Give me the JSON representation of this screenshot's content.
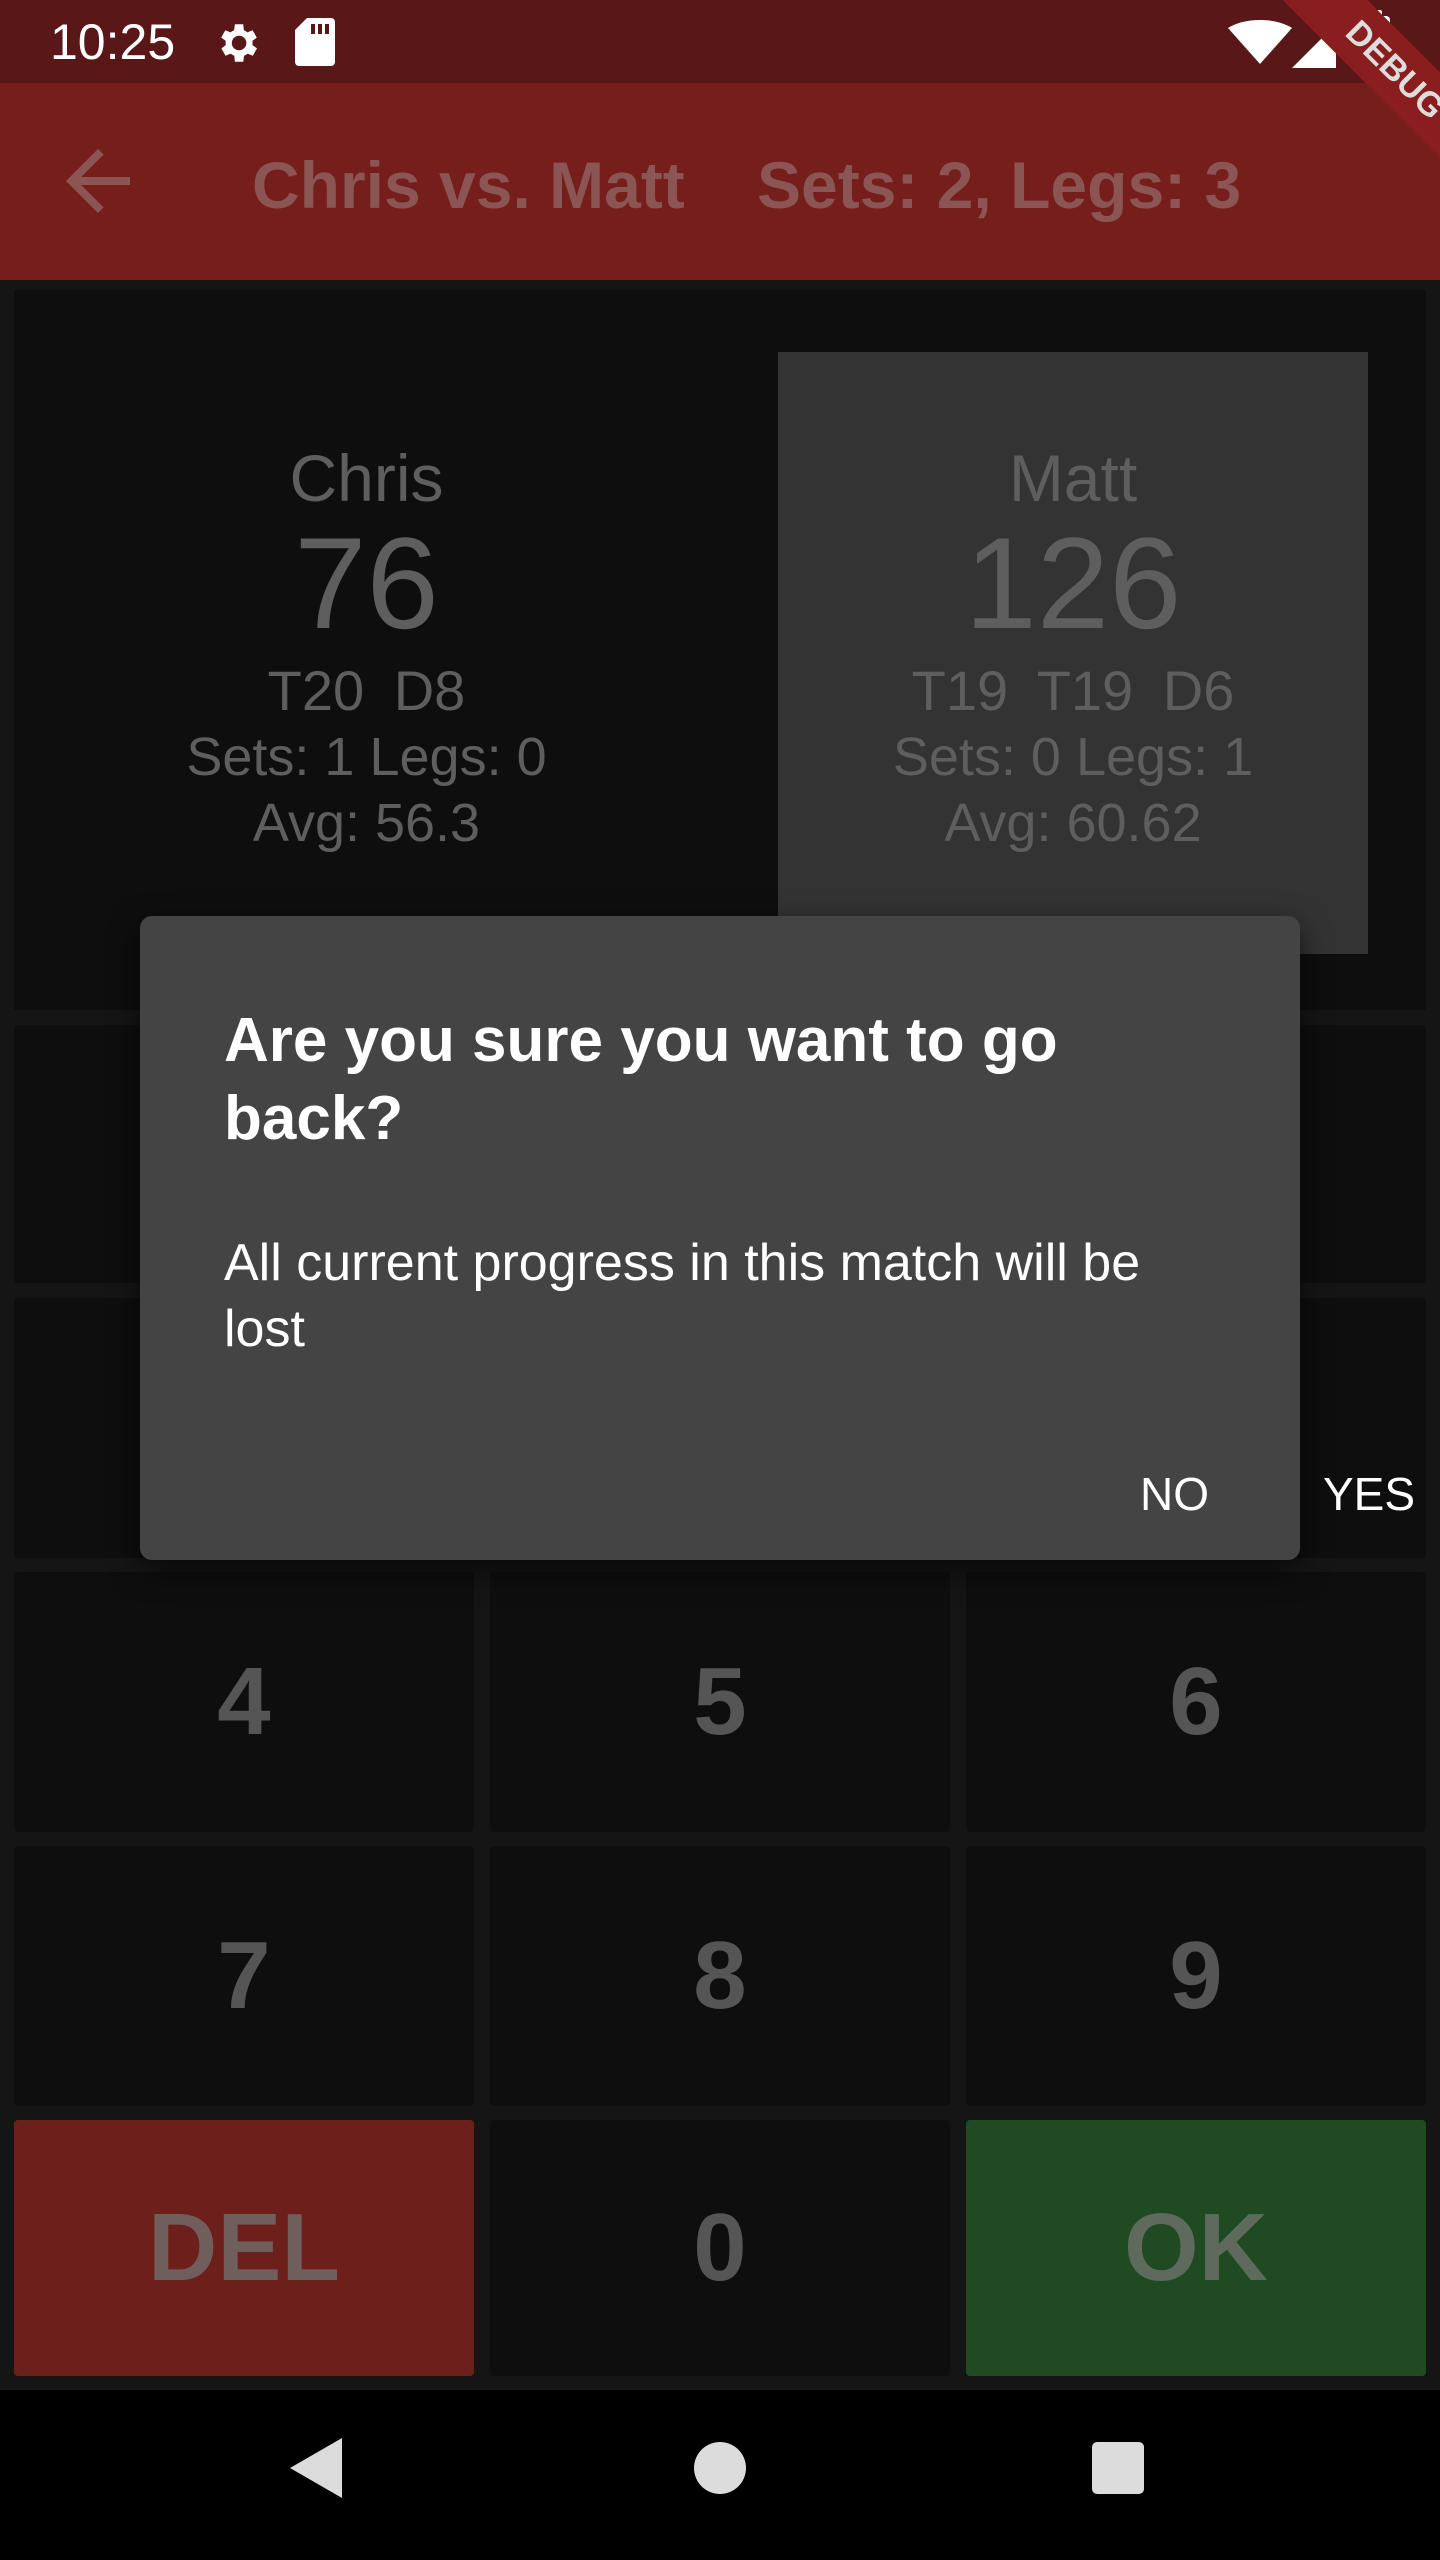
{
  "status_bar": {
    "time": "10:25",
    "icons": [
      "gear-icon",
      "sd-card-icon",
      "wifi-icon",
      "signal-icon",
      "battery-icon"
    ]
  },
  "app_bar": {
    "back_icon": "arrow-left-icon",
    "title": "Chris vs. Matt",
    "match_format": "Sets: 2, Legs: 3",
    "debug_banner": "DEBUG",
    "colors": {
      "background": "#761e1c"
    }
  },
  "players": [
    {
      "name": "Chris",
      "score": "76",
      "checkout": "T20  D8",
      "sets_legs": "Sets: 1   Legs: 0",
      "average": "Avg: 56.3",
      "active": false
    },
    {
      "name": "Matt",
      "score": "126",
      "checkout": "T19  T19  D6",
      "sets_legs": "Sets: 0   Legs: 1",
      "average": "Avg: 60.62",
      "active": true
    }
  ],
  "keypad": {
    "keys": [
      "4",
      "5",
      "6",
      "7",
      "8",
      "9",
      "DEL",
      "0",
      "OK"
    ],
    "colors": {
      "delete": "#6d1f1b",
      "ok": "#1f4a22"
    }
  },
  "dialog": {
    "title": "Are you sure you want to go back?",
    "message": "All current progress in this match will be lost",
    "no_label": "NO",
    "yes_label": "YES"
  },
  "nav_bar": {
    "icons": [
      "back-triangle-icon",
      "home-circle-icon",
      "recents-square-icon"
    ]
  }
}
